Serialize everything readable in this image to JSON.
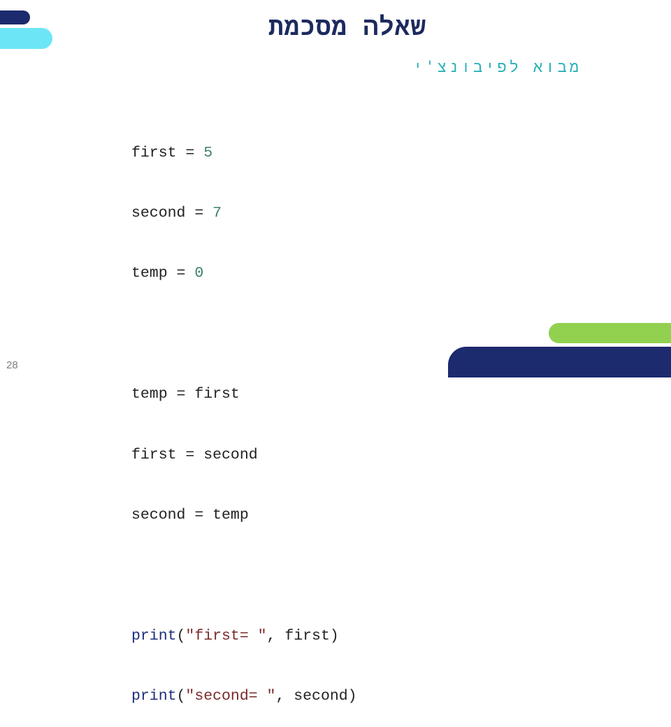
{
  "slide": {
    "title": "שאלה מסכמת",
    "subtitle": "מבוא לפיבונצ'י",
    "page_number": "28"
  },
  "code": {
    "block1": [
      {
        "var": "first",
        "op": " = ",
        "value": "5"
      },
      {
        "var": "second",
        "op": " = ",
        "value": "7"
      },
      {
        "var": "temp",
        "op": " = ",
        "value": "0"
      }
    ],
    "block2": [
      {
        "text": "temp = first"
      },
      {
        "text": "first = second"
      },
      {
        "text": "second = temp"
      }
    ],
    "block3": [
      {
        "func": "print",
        "open": "(",
        "str": "\"first= \"",
        "rest": ", first)"
      },
      {
        "func": "print",
        "open": "(",
        "str": "\"second= \"",
        "rest": ", second)"
      }
    ]
  },
  "colors": {
    "navy": "#1c2a6e",
    "cyan": "#6ce6f7",
    "green": "#92d050",
    "title": "#1c2a5e",
    "subtitle": "#2ab0b8",
    "number": "#3d7f6e",
    "keyword": "#1f2e7a",
    "string": "#7a2a2a"
  }
}
